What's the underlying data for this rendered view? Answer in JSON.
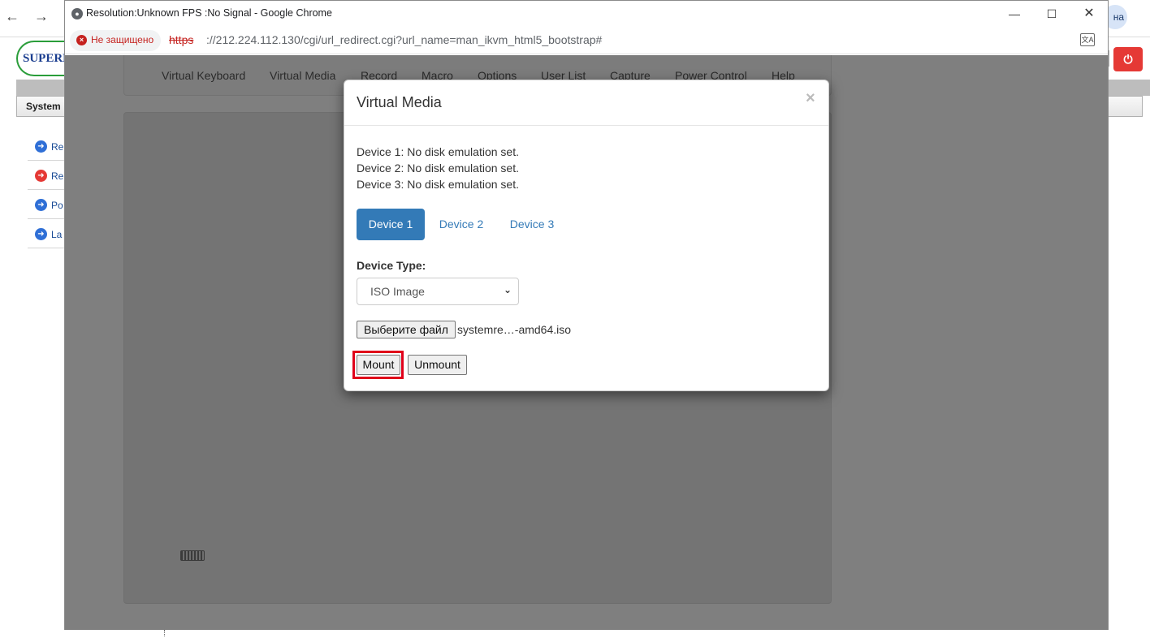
{
  "background_browser": {
    "back_icon": "arrow-left-icon",
    "forward_icon": "arrow-right-icon",
    "profile_text": "на",
    "logo_text": "SUPERM",
    "system_tab_label": "System",
    "sidebar_items": [
      {
        "label": "Re",
        "icon": "arrow-right-circle-icon",
        "color": "#2f6fd6"
      },
      {
        "label": "Re",
        "icon": "arrow-right-circle-icon",
        "color": "#e53935"
      },
      {
        "label": "Po",
        "icon": "arrow-right-circle-icon",
        "color": "#2f6fd6"
      },
      {
        "label": "La",
        "icon": "arrow-right-circle-icon",
        "color": "#2f6fd6"
      }
    ],
    "power_button_icon": "power-icon"
  },
  "popup_window": {
    "title": "Resolution:Unknown FPS :No Signal - Google Chrome",
    "controls": {
      "minimize": "—",
      "maximize": "☐",
      "close": "✕"
    },
    "security_label": "Не защищено",
    "url_scheme": "https",
    "url_rest": "://212.224.112.130/cgi/url_redirect.cgi?url_name=man_ikvm_html5_bootstrap#",
    "translate_icon": "translate-icon"
  },
  "kvm": {
    "menu": [
      "Virtual Keyboard",
      "Virtual Media",
      "Record",
      "Macro",
      "Options",
      "User List",
      "Capture",
      "Power Control",
      "Help"
    ]
  },
  "modal": {
    "title": "Virtual Media",
    "close_symbol": "×",
    "status_lines": [
      "Device 1: No disk emulation set.",
      "Device 2: No disk emulation set.",
      "Device 3: No disk emulation set."
    ],
    "tabs": [
      "Device 1",
      "Device 2",
      "Device 3"
    ],
    "active_tab": "Device 1",
    "device_type_label": "Device Type:",
    "device_type_value": "ISO Image",
    "choose_file_label": "Выберите файл",
    "file_name": "systemre…-amd64.iso",
    "mount_label": "Mount",
    "unmount_label": "Unmount",
    "highlight_color": "#e0001a",
    "accent_color": "#337ab7"
  }
}
